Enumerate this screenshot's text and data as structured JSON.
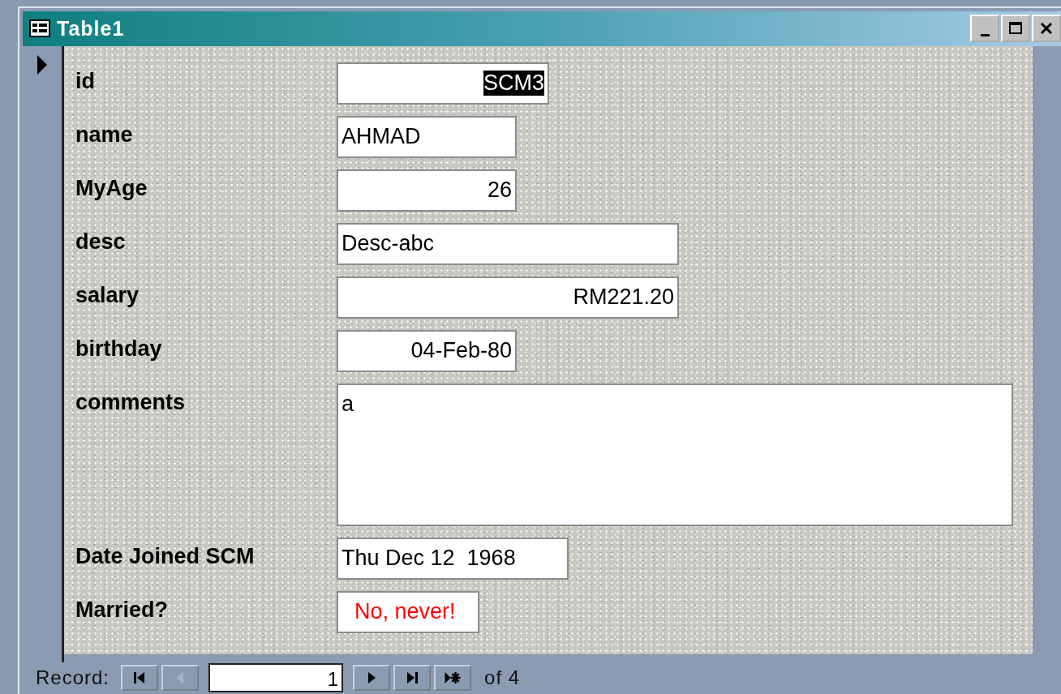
{
  "window": {
    "title": "Table1"
  },
  "fields": [
    {
      "label": "id",
      "value": "SCM3",
      "selected": true,
      "color": "#000000"
    },
    {
      "label": "name",
      "value": "AHMAD",
      "selected": false,
      "color": "#000000"
    },
    {
      "label": "MyAge",
      "value": "26",
      "selected": false,
      "color": "#000000"
    },
    {
      "label": "desc",
      "value": "Desc-abc",
      "selected": false,
      "color": "#000000"
    },
    {
      "label": "salary",
      "value": "RM221.20",
      "selected": false,
      "color": "#000000"
    },
    {
      "label": "birthday",
      "value": "04-Feb-80",
      "selected": false,
      "color": "#000000"
    },
    {
      "label": "comments",
      "value": "a",
      "selected": false,
      "color": "#000000"
    },
    {
      "label": "Date Joined SCM",
      "value": "Thu Dec 12  1968",
      "selected": false,
      "color": "#000000"
    },
    {
      "label": "Married?",
      "value": "No, never!",
      "selected": false,
      "color": "#ff0000"
    }
  ],
  "navigation": {
    "label": "Record:",
    "current": "1",
    "total": "of 4",
    "buttons": [
      {
        "kind": "first",
        "disabled": false
      },
      {
        "kind": "prev",
        "disabled": true
      },
      {
        "kind": "next",
        "disabled": false
      },
      {
        "kind": "last",
        "disabled": false
      },
      {
        "kind": "new",
        "disabled": false
      }
    ]
  }
}
